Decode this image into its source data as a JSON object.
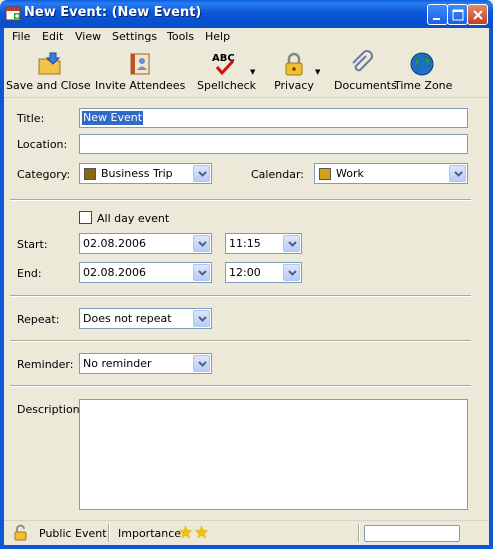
{
  "window": {
    "title": "New Event: (New Event)",
    "icons": {
      "app": "calendar-app-icon",
      "minimize": "minimize-icon",
      "maximize": "maximize-icon",
      "close": "close-icon"
    }
  },
  "menu": [
    "File",
    "Edit",
    "View",
    "Settings",
    "Tools",
    "Help"
  ],
  "toolbar": {
    "save_close": "Save and Close",
    "invite": "Invite Attendees",
    "spellcheck": "Spellcheck",
    "privacy": "Privacy",
    "documents": "Documents",
    "timezone": "Time Zone"
  },
  "form": {
    "title_label": "Title:",
    "title_value": "New Event",
    "location_label": "Location:",
    "location_value": "",
    "category_label": "Category:",
    "category_value": "Business Trip",
    "calendar_label": "Calendar:",
    "calendar_value": "Work",
    "all_day_label": "All day event",
    "all_day_checked": false,
    "start_label": "Start:",
    "start_date": "02.08.2006",
    "start_time": "11:15",
    "end_label": "End:",
    "end_date": "02.08.2006",
    "end_time": "12:00",
    "repeat_label": "Repeat:",
    "repeat_value": "Does not repeat",
    "reminder_label": "Reminder:",
    "reminder_value": "No reminder",
    "description_label": "Description:",
    "description_value": ""
  },
  "status": {
    "privacy_text": "Public Event",
    "importance_label": "Importance:",
    "importance_stars": 2
  },
  "colors": {
    "category_swatch": "#8b6914",
    "calendar_swatch": "#d4a017",
    "title_bar": "#0b58d8",
    "selection": "#316ac5"
  }
}
